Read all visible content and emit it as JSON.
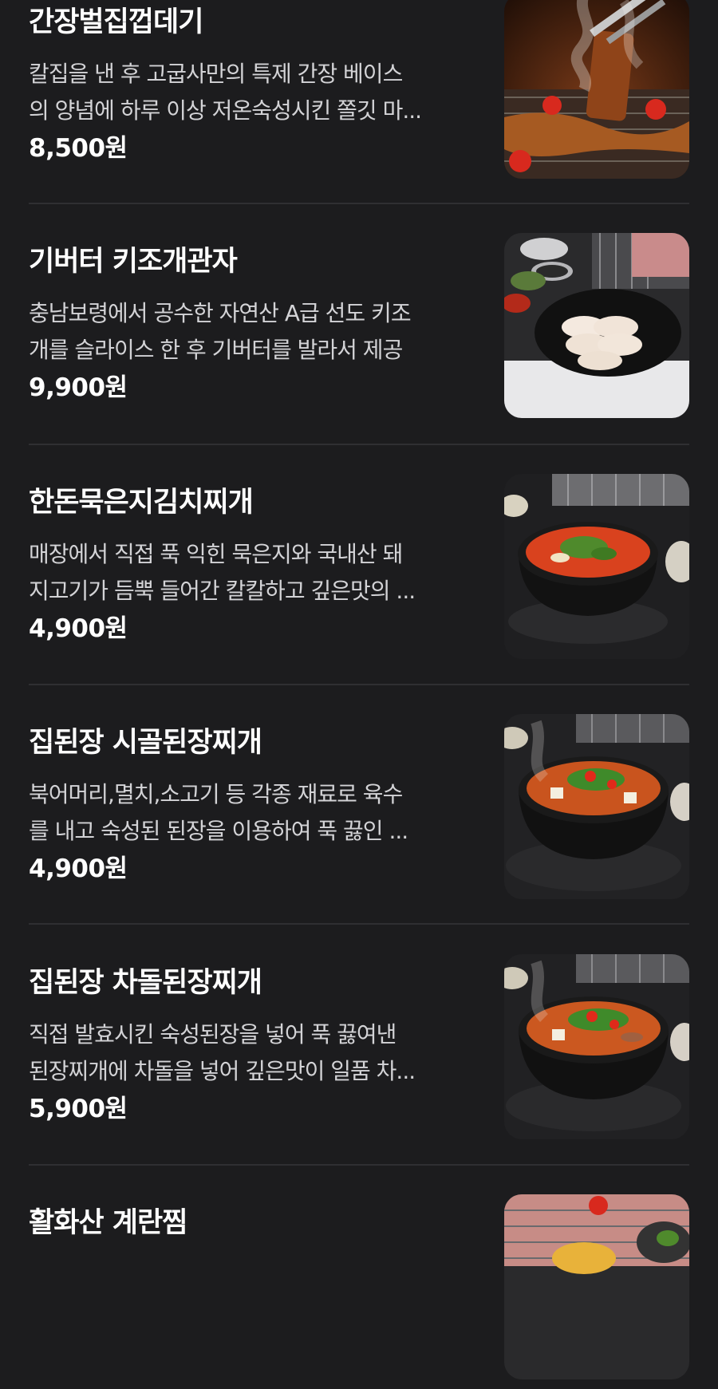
{
  "menu": {
    "items": [
      {
        "name": "간장벌집껍데기",
        "desc_line1": "칼집을 낸 후 고굽사만의 특제 간장 베이스",
        "desc_line2": "의 양념에 하루 이상 저온숙성시킨 쫄깃 마...",
        "price": "8,500원",
        "image": "grilled-pork-skin-photo"
      },
      {
        "name": "기버터 키조개관자",
        "desc_line1": "충남보령에서 공수한 자연산 A급 선도 키조",
        "desc_line2": "개를 슬라이스 한 후 기버터를 발라서 제공",
        "price": "9,900원",
        "image": "scallop-plate-photo"
      },
      {
        "name": "한돈묵은지김치찌개",
        "desc_line1": "매장에서 직접 푹 익힌 묵은지와 국내산 돼",
        "desc_line2": "지고기가 듬뿍 들어간 칼칼하고 깊은맛의 ...",
        "price": "4,900원",
        "image": "kimchi-stew-photo"
      },
      {
        "name": "집된장 시골된장찌개",
        "desc_line1": "북어머리,멸치,소고기 등 각종 재료로 육수",
        "desc_line2": "를 내고 숙성된 된장을 이용하여 푹 끓인 ...",
        "price": "4,900원",
        "image": "soybean-stew-photo"
      },
      {
        "name": "집된장 차돌된장찌개",
        "desc_line1": "직접 발효시킨 숙성된장을 넣어 푹 끓여낸",
        "desc_line2": "된장찌개에 차돌을 넣어 깊은맛이 일품 차...",
        "price": "5,900원",
        "image": "brisket-soybean-stew-photo"
      },
      {
        "name": "활화산 계란찜",
        "desc_line1": "",
        "desc_line2": "",
        "price": "",
        "image": "steamed-egg-photo"
      }
    ]
  },
  "colors": {
    "background": "#1c1c1e",
    "divider": "#2f2f32",
    "title": "#ffffff",
    "description": "#d3d3d6"
  }
}
